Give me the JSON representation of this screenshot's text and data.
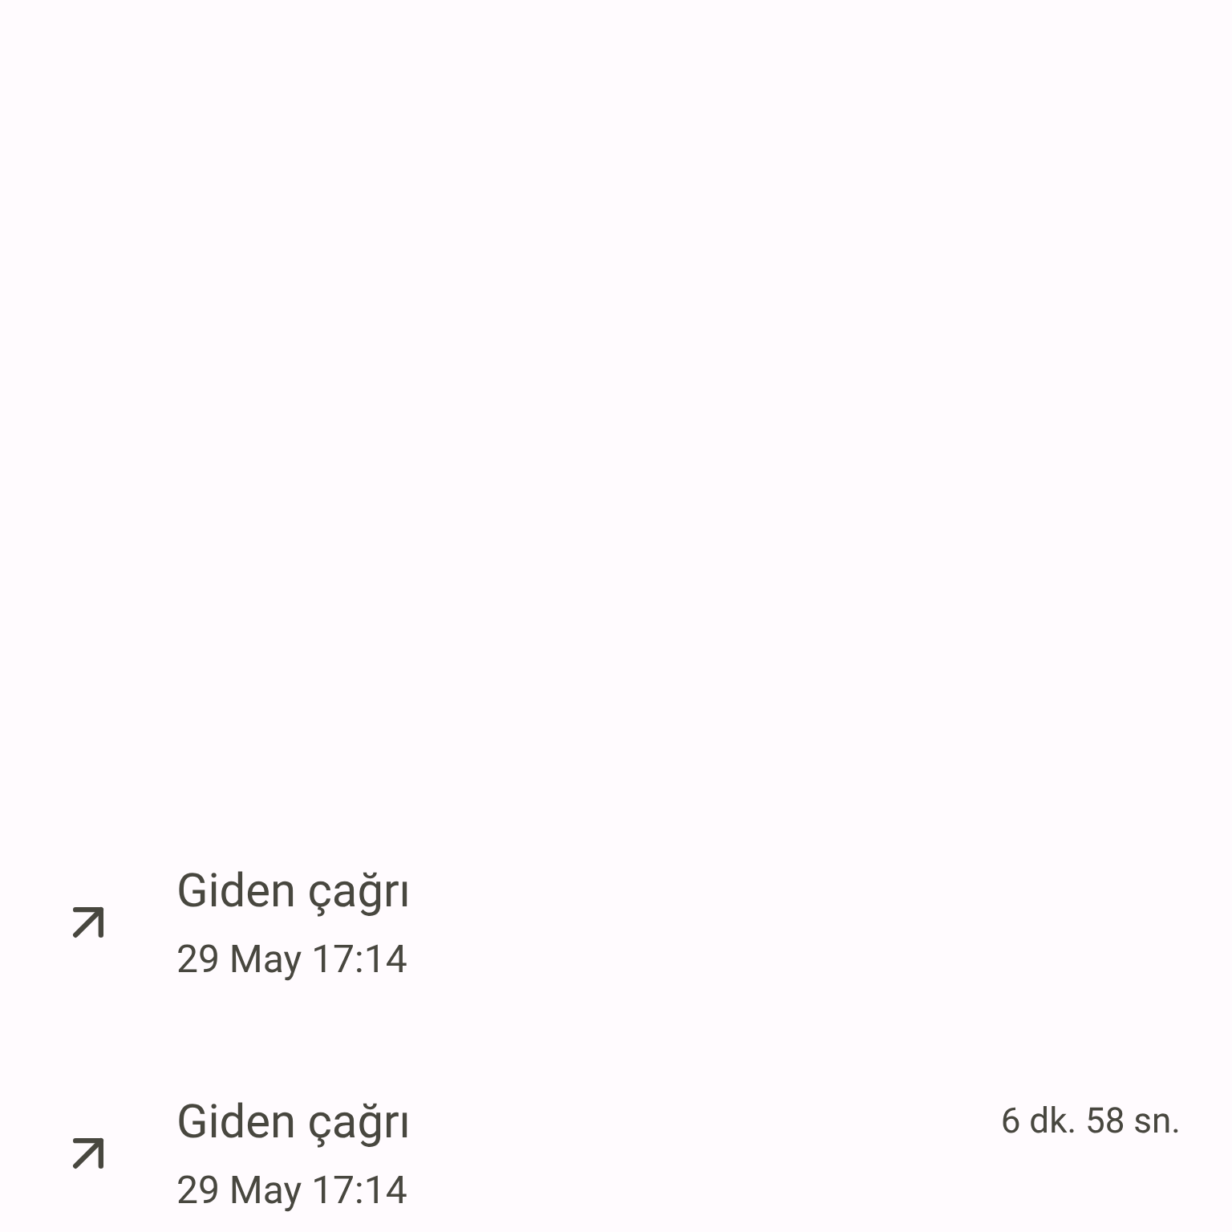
{
  "calls": [
    {
      "title": "Giden çağrı",
      "date": "29 May 17:14"
    },
    {
      "title": "Giden çağrı",
      "date": "29 May 17:14",
      "duration": "6 dk. 58 sn."
    }
  ]
}
